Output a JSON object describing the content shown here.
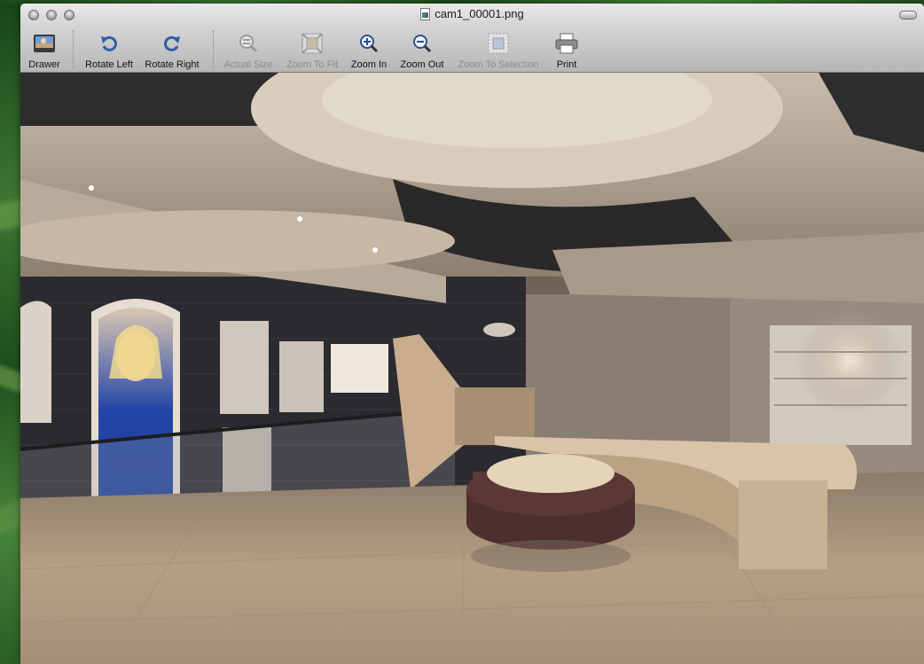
{
  "window": {
    "title": "cam1_00001.png"
  },
  "toolbar": {
    "items": [
      {
        "label": "Drawer",
        "icon": "drawer-icon",
        "enabled": true
      },
      {
        "label": "Rotate Left",
        "icon": "rotate-left-icon",
        "enabled": true
      },
      {
        "label": "Rotate Right",
        "icon": "rotate-right-icon",
        "enabled": true
      },
      {
        "label": "Actual Size",
        "icon": "actual-size-icon",
        "enabled": false
      },
      {
        "label": "Zoom To Fit",
        "icon": "zoom-to-fit-icon",
        "enabled": false
      },
      {
        "label": "Zoom In",
        "icon": "zoom-in-icon",
        "enabled": true
      },
      {
        "label": "Zoom Out",
        "icon": "zoom-out-icon",
        "enabled": true
      },
      {
        "label": "Zoom To Selection",
        "icon": "zoom-to-selection-icon",
        "enabled": false
      },
      {
        "label": "Print",
        "icon": "print-icon",
        "enabled": true
      }
    ]
  },
  "image": {
    "description_icon": "rendered-interior-image"
  },
  "colors": {
    "toolbar_disabled_text": "#8c8c8c",
    "toolbar_text": "#111111",
    "icon_blue": "#2f5fa8"
  }
}
